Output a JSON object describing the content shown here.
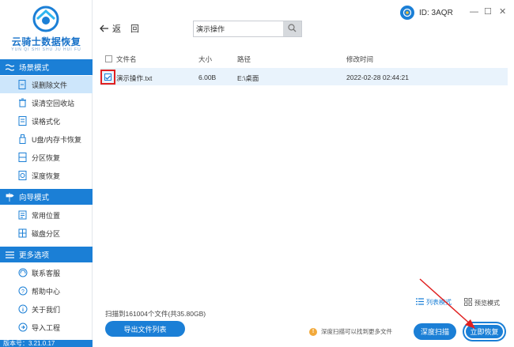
{
  "app": {
    "logo_title": "云骑士数据恢复",
    "logo_sub": "YUN QI SHI SHU JU HUI FU"
  },
  "sidebar": {
    "sections": [
      {
        "title": "场景模式",
        "icon": "wave-icon"
      },
      {
        "title": "向导模式",
        "icon": "signpost-icon"
      },
      {
        "title": "更多选项",
        "icon": "menu-icon"
      }
    ],
    "scene_items": [
      {
        "label": "误删除文件",
        "icon": "file-delete-icon",
        "active": true
      },
      {
        "label": "误清空回收站",
        "icon": "recycle-icon",
        "active": false
      },
      {
        "label": "误格式化",
        "icon": "format-icon",
        "active": false
      },
      {
        "label": "U盘/内存卡恢复",
        "icon": "usb-icon",
        "active": false
      },
      {
        "label": "分区恢复",
        "icon": "partition-icon",
        "active": false
      },
      {
        "label": "深度恢复",
        "icon": "deep-restore-icon",
        "active": false
      }
    ],
    "guide_items": [
      {
        "label": "常用位置",
        "icon": "location-icon"
      },
      {
        "label": "磁盘分区",
        "icon": "disk-icon"
      }
    ],
    "more_items": [
      {
        "label": "联系客服",
        "icon": "headset-icon"
      },
      {
        "label": "帮助中心",
        "icon": "help-icon"
      },
      {
        "label": "关于我们",
        "icon": "info-icon"
      },
      {
        "label": "导入工程",
        "icon": "import-icon"
      }
    ],
    "version": "版本号：3.21.0.17"
  },
  "toolbar": {
    "back_label": "返",
    "back_label2": "回",
    "search_value": "演示操作"
  },
  "user": {
    "id_label": "ID: 3AQR"
  },
  "window_controls": {
    "minimize": "—",
    "maximize": "☐",
    "close": "✕"
  },
  "table": {
    "columns": [
      "文件名",
      "大小",
      "路径",
      "修改时间"
    ],
    "rows": [
      {
        "name": "演示操作.txt",
        "size": "6.00B",
        "path": "E:\\桌面",
        "modified": "2022-02-28 02:44:21",
        "checked": true
      }
    ]
  },
  "footer": {
    "scan_info": "扫描到161004个文件(共35.80GB)",
    "export_button": "导出文件列表",
    "list_mode": "列表模式",
    "preview_mode": "预览模式",
    "tip": "深度扫描可以找到更多文件",
    "deep_scan_button": "深度扫描",
    "restore_button": "立即恢复"
  },
  "colors": {
    "accent": "#1b7fd6",
    "active_bg": "#cde6fb",
    "highlight": "#e02020"
  }
}
